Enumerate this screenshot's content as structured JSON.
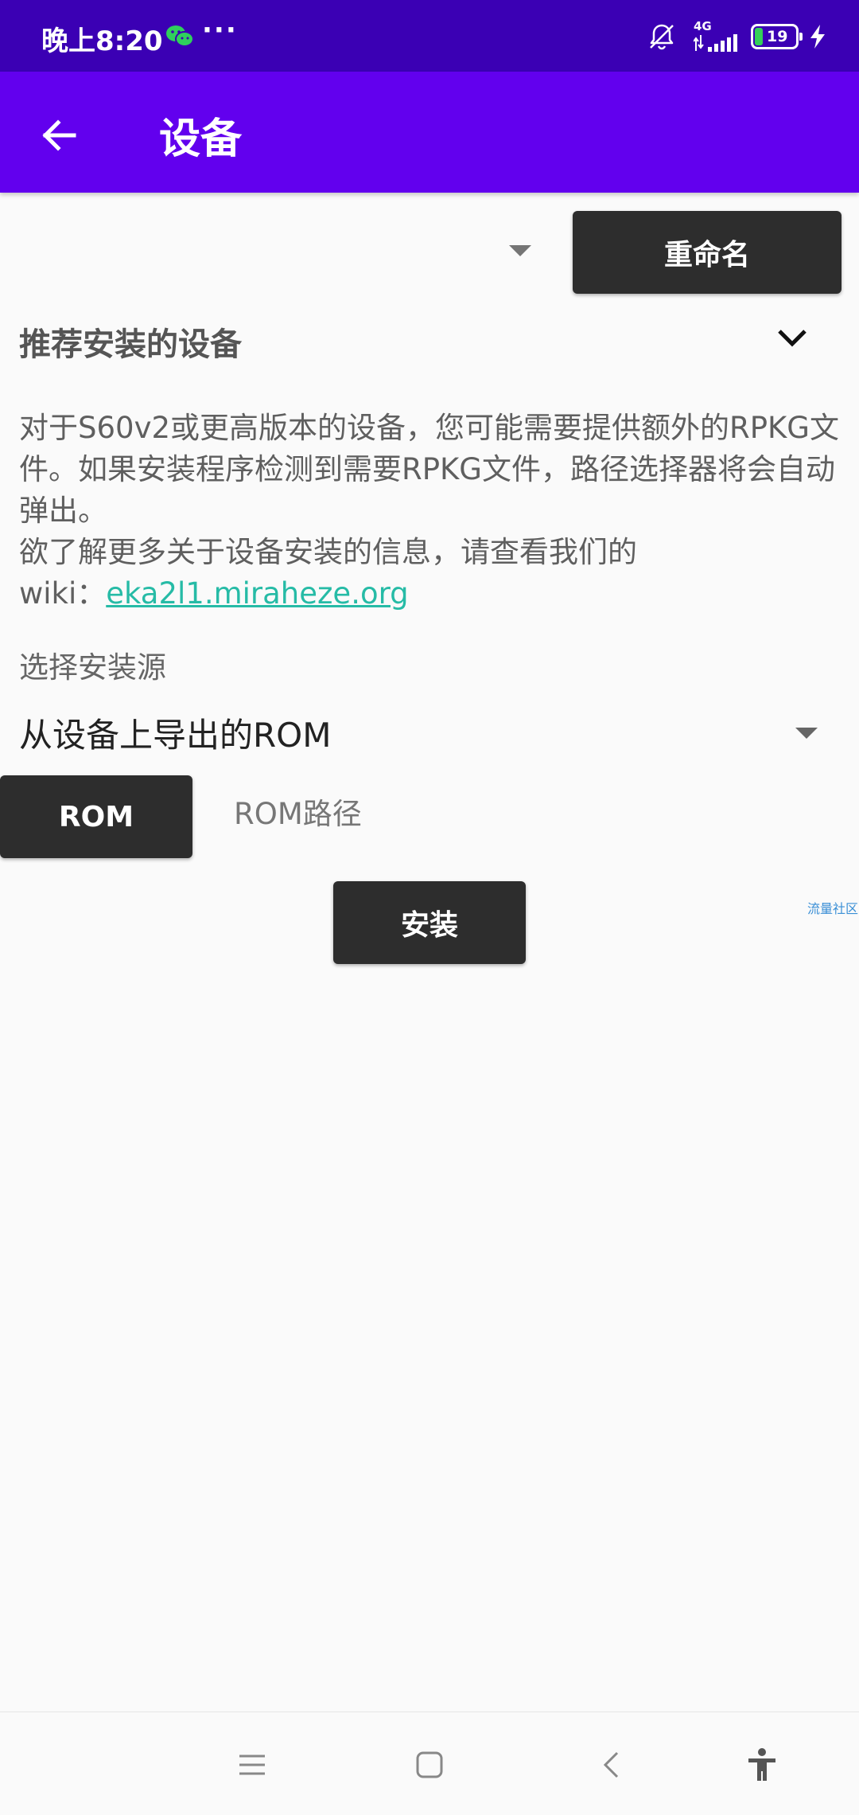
{
  "status_bar": {
    "time": "晚上8:20",
    "dots": "···",
    "network": "4G",
    "battery": "19",
    "battery_level_percent": 19
  },
  "app_bar": {
    "title": "设备",
    "back_icon": "arrow-left-icon"
  },
  "toolbar": {
    "rename_label": "重命名"
  },
  "recommend": {
    "title": "推荐安装的设备",
    "desc_line1": "对于S60v2或更高版本的设备，您可能需要提供额外的RPKG文件。如果安装程序检测到需要RPKG文件，路径选择器将会自动弹出。",
    "desc_line2": "欲了解更多关于设备安装的信息，请查看我们的",
    "wiki_prefix": "wiki：",
    "wiki_link": "eka2l1.miraheze.org"
  },
  "source": {
    "label": "选择安装源",
    "selected": "从设备上导出的ROM",
    "rom_button": "ROM",
    "rom_path_placeholder": "ROM路径",
    "install_button": "安装"
  },
  "watermark": "流量社区",
  "nav_bar": {
    "items": [
      "menu-icon",
      "home-icon",
      "back-icon",
      "accessibility-icon"
    ]
  },
  "colors": {
    "status_bar": "#3b00b4",
    "app_bar": "#6200ee",
    "button": "#2d2d2d",
    "link": "#26bba6"
  }
}
